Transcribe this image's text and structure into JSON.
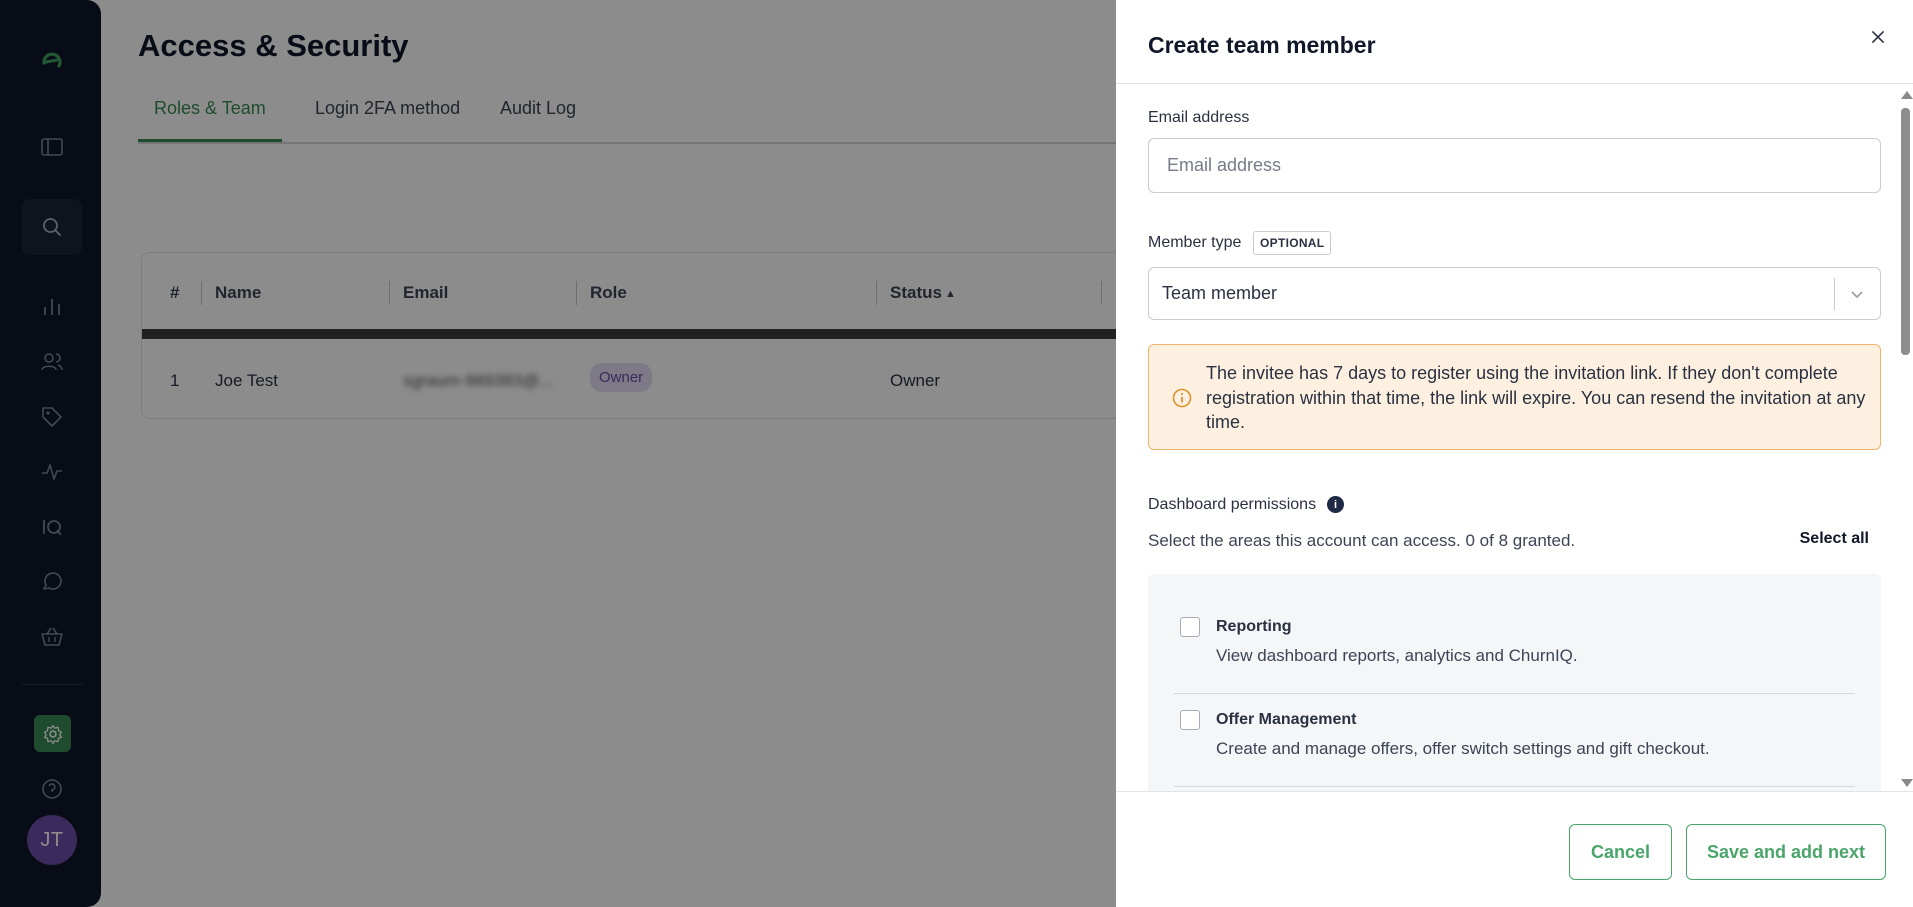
{
  "page": {
    "title": "Access & Security"
  },
  "tabs": [
    {
      "label": "Roles & Team",
      "active": true
    },
    {
      "label": "Login 2FA method",
      "active": false
    },
    {
      "label": "Audit Log",
      "active": false
    }
  ],
  "table": {
    "columns": [
      "#",
      "Name",
      "Email",
      "Role",
      "Status"
    ],
    "rows": [
      {
        "num": "1",
        "name": "Joe Test",
        "email": "sgraum-989383@...",
        "role": "Owner",
        "status": "Owner"
      }
    ]
  },
  "sidebar": {
    "icons": [
      "logo-icon",
      "panel-icon",
      "search-icon",
      "chart-icon",
      "users-icon",
      "tag-icon",
      "activity-icon",
      "iq-icon",
      "chat-icon",
      "basket-icon",
      "settings-icon",
      "help-icon"
    ],
    "avatar_initials": "JT",
    "accent": "#3a8a55"
  },
  "drawer": {
    "title": "Create team member",
    "email": {
      "label": "Email address",
      "placeholder": "Email address",
      "value": ""
    },
    "member_type": {
      "label": "Member type",
      "badge": "OPTIONAL",
      "value": "Team member"
    },
    "notice": {
      "text": "The invitee has 7 days to register using the invitation link. If they don't complete registration within that time, the link will expire. You can resend the invitation at any time."
    },
    "permissions": {
      "label": "Dashboard permissions",
      "info": "i",
      "subtitle": "Select the areas this account can access. 0 of 8 granted.",
      "select_all": "Select all",
      "items": [
        {
          "title": "Reporting",
          "description": "View dashboard reports, analytics and ChurnIQ.",
          "checked": false
        },
        {
          "title": "Offer Management",
          "description": "Create and manage offers, offer switch settings and gift checkout.",
          "checked": false
        }
      ]
    },
    "footer": {
      "cancel": "Cancel",
      "save": "Save and add next"
    }
  },
  "colors": {
    "brand_green": "#4aa56b",
    "notice_bg": "#fdf0e0",
    "notice_border": "#f2b46b",
    "sidebar_bg": "#0f1728"
  }
}
